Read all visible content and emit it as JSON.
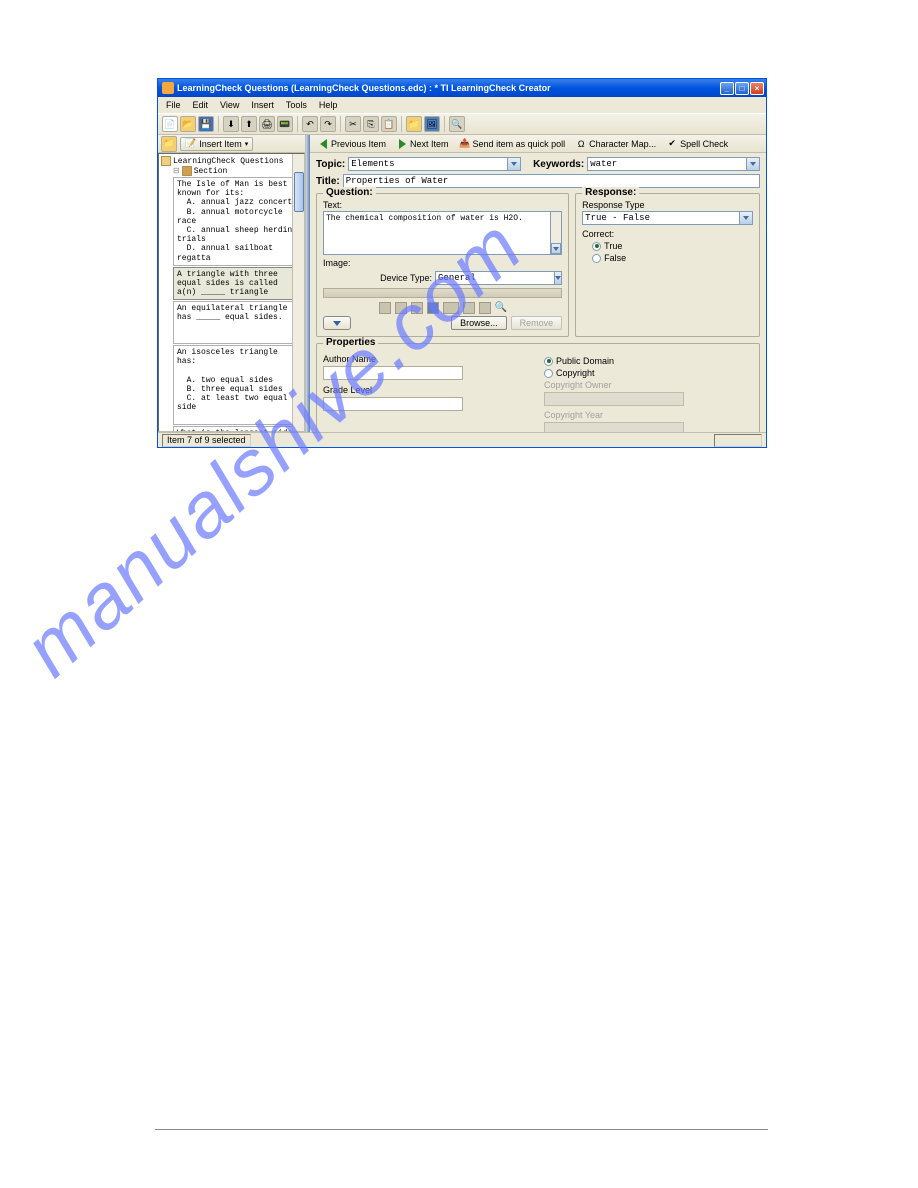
{
  "window": {
    "title": "LearningCheck Questions (LearningCheck Questions.edc) : *   TI LearningCheck Creator"
  },
  "menu": [
    "File",
    "Edit",
    "View",
    "Insert",
    "Tools",
    "Help"
  ],
  "leftToolbar": {
    "insertItem": "Insert Item"
  },
  "tree": {
    "root": "LearningCheck Questions",
    "section": "Section",
    "items": [
      "The Isle of Man is best known for its:\n  A. annual jazz concert\n  B. annual motorcycle race\n  C. annual sheep herding trials\n  D. annual sailboat regatta",
      "A triangle with three equal sides is called a(n) _____ triangle",
      "An equilateral triangle has _____ equal sides.",
      "An isosceles triangle has:\n\n  A. two equal sides\n  B. three equal sides\n  C. at least two equal side",
      "What is the longest side of a right triangle"
    ]
  },
  "rightToolbar": {
    "previousItem": "Previous Item",
    "nextItem": "Next Item",
    "sendQuickPoll": "Send item as quick poll",
    "characterMap": "Character Map...",
    "spellCheck": "Spell Check"
  },
  "form": {
    "topicLabel": "Topic:",
    "topicValue": "Elements",
    "keywordsLabel": "Keywords:",
    "keywordsValue": "water",
    "titleLabel": "Title:",
    "titleValue": "Properties of Water"
  },
  "questionPanel": {
    "legend": "Question:",
    "textLabel": "Text:",
    "textValue": "The chemical composition of water is H2O.",
    "imageLabel": "Image:",
    "deviceTypeLabel": "Device Type:",
    "deviceTypeValue": "General",
    "browseLabel": "Browse...",
    "removeLabel": "Remove"
  },
  "responsePanel": {
    "legend": "Response:",
    "typeLabel": "Response Type",
    "typeValue": "True - False",
    "correctLabel": "Correct:",
    "trueLabel": "True",
    "falseLabel": "False"
  },
  "propertiesPanel": {
    "legend": "Properties",
    "authorLabel": "Author Name",
    "gradeLabel": "Grade Level",
    "publicDomainLabel": "Public Domain",
    "copyrightLabel": "Copyright",
    "ownerLabel": "Copyright Owner",
    "yearLabel": "Copyright Year"
  },
  "statusbar": {
    "text": "Item 7 of 9 selected"
  },
  "watermark": "manualshive.com"
}
